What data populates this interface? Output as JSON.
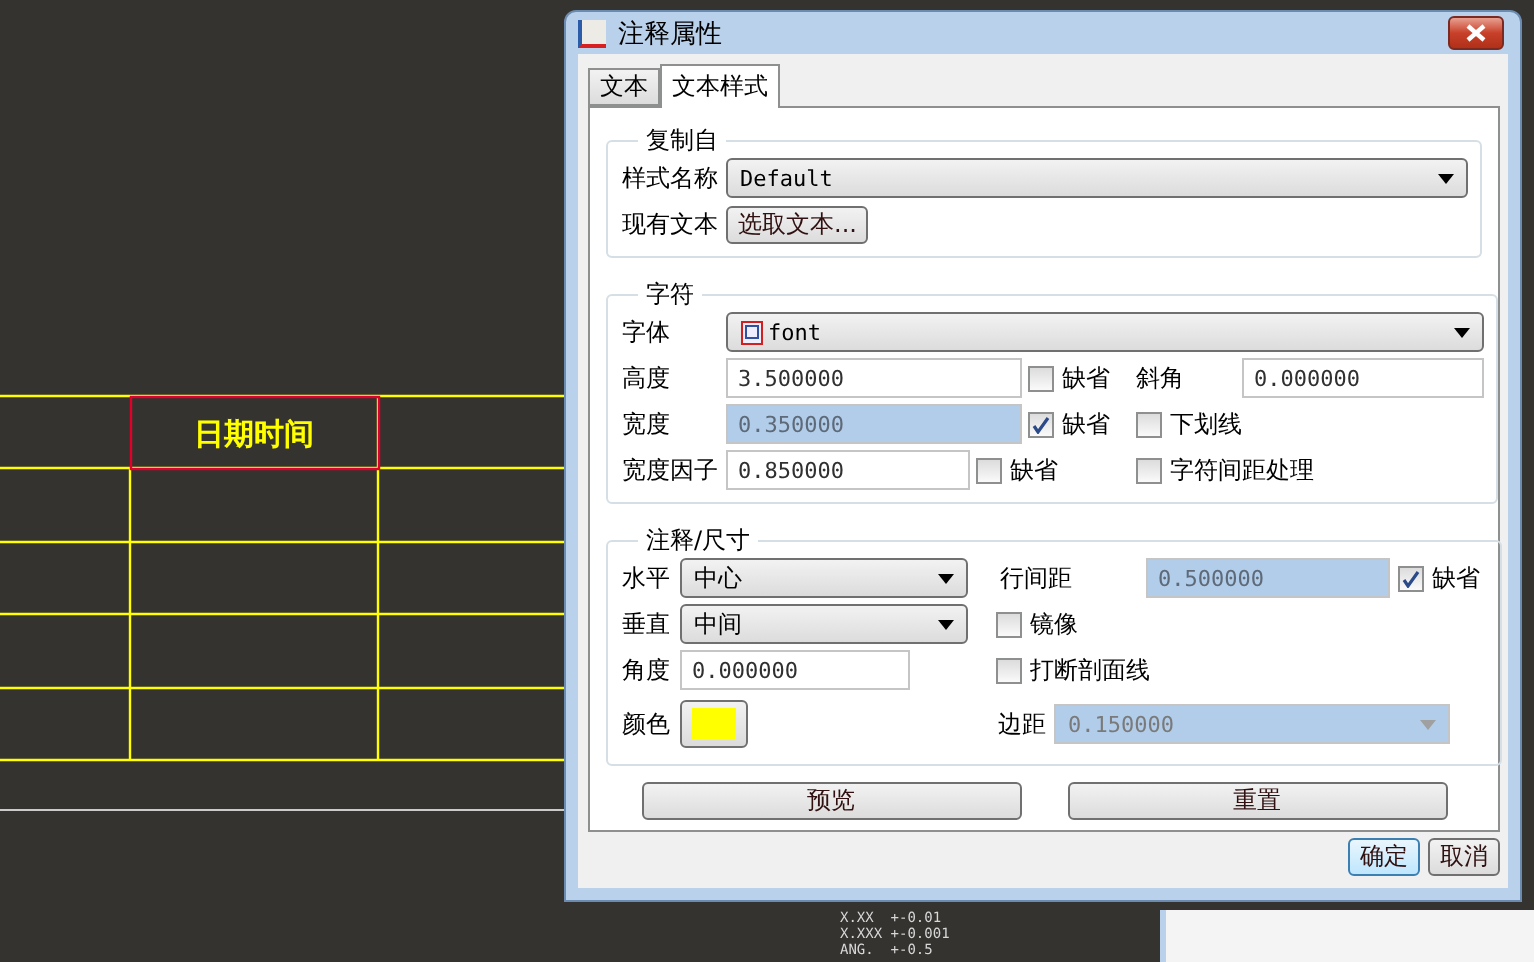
{
  "window": {
    "title": "注释属性"
  },
  "tabs": [
    {
      "label": "文本",
      "selected": false
    },
    {
      "label": "文本样式",
      "selected": true
    }
  ],
  "copy_from": {
    "title": "复制自",
    "style_name": {
      "label": "样式名称",
      "value": "Default"
    },
    "existing_text": {
      "label": "现有文本",
      "button": "选取文本..."
    }
  },
  "character": {
    "title": "字符",
    "font": {
      "label": "字体",
      "value": "font"
    },
    "height": {
      "label": "高度",
      "value": "3.500000",
      "disabled": false,
      "default": {
        "label": "缺省",
        "checked": false
      }
    },
    "slant": {
      "label": "斜角",
      "value": "0.000000"
    },
    "width": {
      "label": "宽度",
      "value": "0.350000",
      "disabled": true,
      "default": {
        "label": "缺省",
        "checked": true
      }
    },
    "underline": {
      "label": "下划线",
      "checked": false
    },
    "width_factor": {
      "label": "宽度因子",
      "value": "0.850000",
      "disabled": false,
      "default": {
        "label": "缺省",
        "checked": false
      }
    },
    "kerning": {
      "label": "字符间距处理",
      "checked": false
    }
  },
  "note_dimension": {
    "title": "注释/尺寸",
    "horizontal": {
      "label": "水平",
      "value": "中心"
    },
    "vertical": {
      "label": "垂直",
      "value": "中间"
    },
    "line_spacing": {
      "label": "行间距",
      "value": "0.500000",
      "disabled": true,
      "default": {
        "label": "缺省",
        "checked": true
      }
    },
    "mirror": {
      "label": "镜像",
      "checked": false
    },
    "angle": {
      "label": "角度",
      "value": "0.000000"
    },
    "break_hatch": {
      "label": "打断剖面线",
      "checked": false
    },
    "color": {
      "label": "颜色",
      "color": "#ffff00"
    },
    "margin": {
      "label": "边距",
      "value": "0.150000",
      "disabled": true
    }
  },
  "action_buttons": [
    "预览",
    "重置"
  ],
  "dialog_buttons": [
    {
      "label": "确定",
      "default": true
    },
    {
      "label": "取消",
      "default": false
    }
  ],
  "canvas": {
    "table_header": "日期时间",
    "tolerance_notes": [
      "X.XX  +-0.01",
      "X.XXX +-0.001",
      "ANG.  +-0.5"
    ]
  }
}
